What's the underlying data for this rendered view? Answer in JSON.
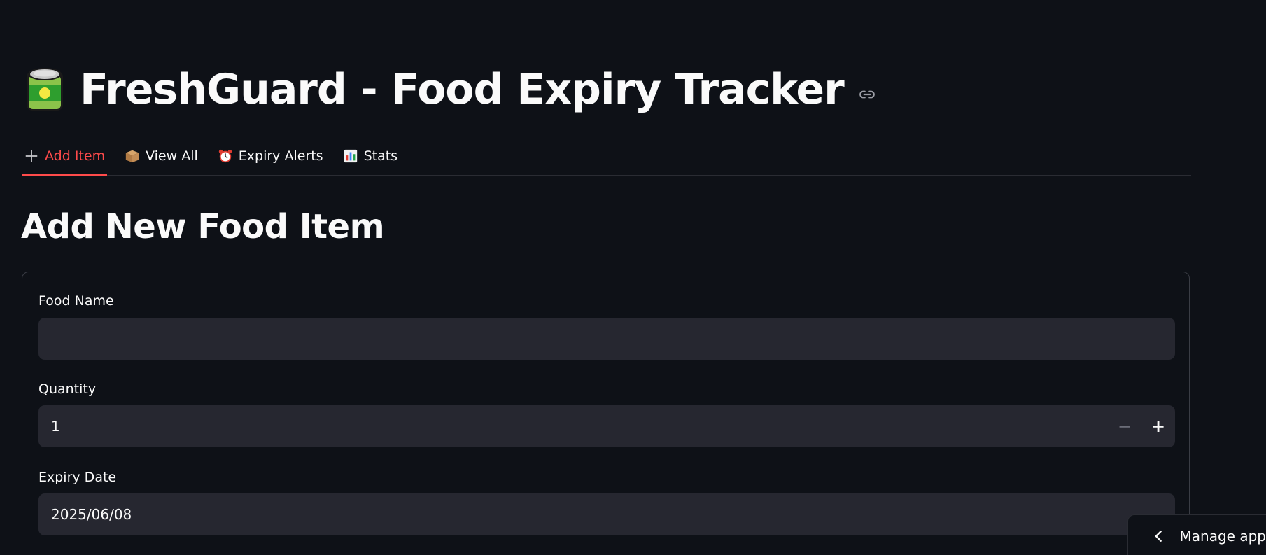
{
  "header": {
    "title": "FreshGuard - Food Expiry Tracker",
    "title_icon": "canned-food-icon",
    "link_icon": "link-icon"
  },
  "tabs": [
    {
      "label": "Add Item",
      "icon": "plus-icon",
      "active": true
    },
    {
      "label": "View All",
      "icon": "package-icon",
      "active": false
    },
    {
      "label": "Expiry Alerts",
      "icon": "alarm-clock-icon",
      "active": false
    },
    {
      "label": "Stats",
      "icon": "bar-chart-icon",
      "active": false
    }
  ],
  "main": {
    "section_title": "Add New Food Item",
    "form": {
      "food_name": {
        "label": "Food Name",
        "value": ""
      },
      "quantity": {
        "label": "Quantity",
        "value": "1",
        "minus_label": "−",
        "plus_label": "+"
      },
      "expiry_date": {
        "label": "Expiry Date",
        "value": "2025/06/08"
      }
    }
  },
  "footer": {
    "manage_app_label": "Manage app"
  },
  "colors": {
    "background": "#0e1117",
    "accent": "#ff4b4b",
    "field_bg": "#262730",
    "text": "#fafafa"
  }
}
